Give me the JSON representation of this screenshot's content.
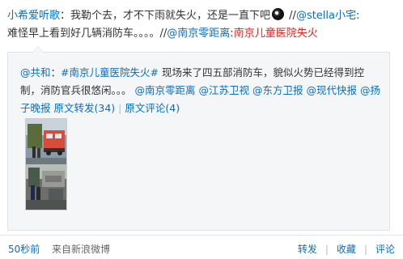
{
  "post": {
    "author": "小希爱听歌",
    "text1": "：我勒个去，才不下雨就失火，还是一直下吧",
    "sep1": " //",
    "mention1": "@stella小宅",
    "text2": ":",
    "line2_start": "难怪早上看到好几辆消防车。。。。",
    "sep2": "//",
    "mention2": "@南京零距离",
    "text3": ":",
    "topic": "南京儿童医院失火"
  },
  "quote": {
    "author": "@共和",
    "colon": "：",
    "topic": "#南京儿童医院失火#",
    "body": " 现场来了四五部消防车，貌似火势已经得到控制，消防官兵很悠闲。。。",
    "mentions": [
      "@南京零距离",
      "@江苏卫视",
      "@东方卫报",
      "@现代快报",
      "@扬子晚报"
    ],
    "repost_link": "原文转发(34)",
    "separator": "|",
    "comment_link": "原文评论(4)"
  },
  "footer": {
    "time": "50秒前",
    "source": "来自新浪微博",
    "repost": "转发",
    "favorite": "收藏",
    "comment": "评论",
    "divider": "|"
  },
  "icons": {
    "emoticon": "emoticon-icon",
    "thumbnail": "photo-thumbnail"
  }
}
